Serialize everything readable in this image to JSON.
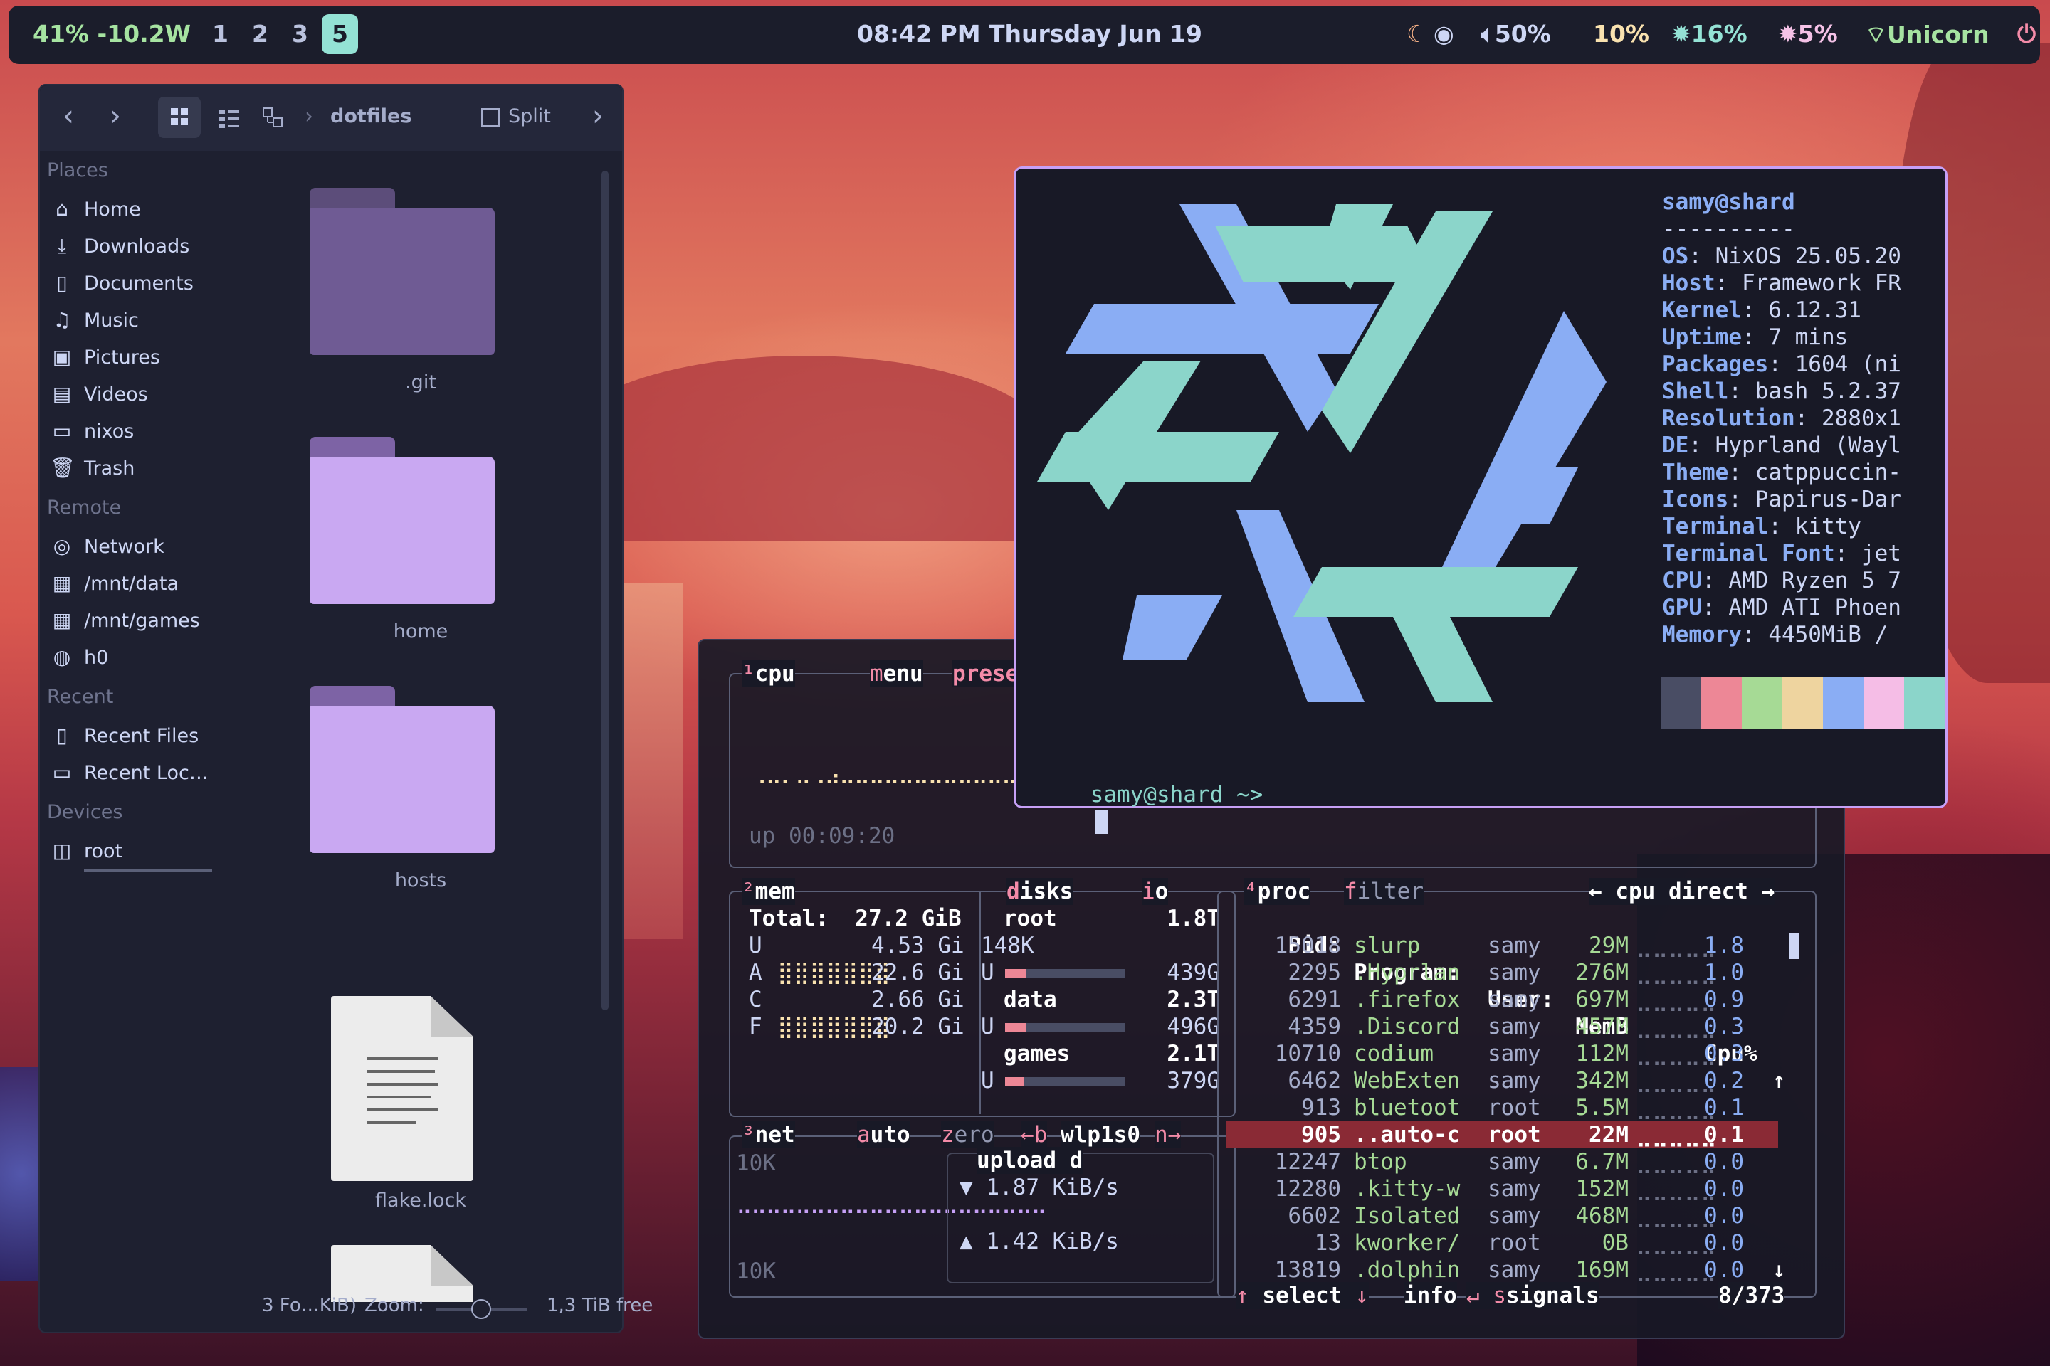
{
  "topbar": {
    "battery": "41% -10.2W",
    "workspaces": [
      "1",
      "2",
      "3",
      "5"
    ],
    "active_workspace": "5",
    "clock": "08:42 PM  Thursday Jun 19",
    "volume": "50%",
    "brightness": "10%",
    "cpu": "16%",
    "ram": "5%",
    "wifi": "Unicorn",
    "colors": {
      "battery": "#a6e3a1",
      "brightness": "#f9e2af",
      "accent": "#94e2d5"
    }
  },
  "file_manager": {
    "breadcrumb": "dotfiles",
    "split_label": "Split",
    "sections": {
      "places": "Places",
      "remote": "Remote",
      "recent": "Recent",
      "devices": "Devices"
    },
    "places": [
      "Home",
      "Downloads",
      "Documents",
      "Music",
      "Pictures",
      "Videos",
      "nixos",
      "Trash"
    ],
    "remote": [
      "Network",
      "/mnt/data",
      "/mnt/games",
      "h0"
    ],
    "recent": [
      "Recent Files",
      "Recent Loc…"
    ],
    "devices": [
      "root"
    ],
    "files": [
      ".git",
      "home",
      "hosts",
      "flake.lock"
    ],
    "status_left": "3 Fo…KiB)",
    "zoom_label": "Zoom:",
    "free_space": "1,3 TiB free"
  },
  "btop": {
    "cpu_box": {
      "num": "¹",
      "title": "cpu",
      "menu": "menu",
      "preset": "prese",
      "uptime": "up 00:09:20"
    },
    "mem_box": {
      "num": "²",
      "title": "mem",
      "total": "Total:  27.2 GiB",
      "rows": [
        {
          "k": "U",
          "v": "4.53 Gi"
        },
        {
          "k": "A",
          "v": "22.6 Gi"
        },
        {
          "k": "C",
          "v": "2.66 Gi"
        },
        {
          "k": "F",
          "v": "20.2 Gi"
        }
      ]
    },
    "disks_box": {
      "title": "disks",
      "io": "io",
      "disks": [
        {
          "name": "root",
          "size": "1.8T",
          "line2": "148K",
          "used_label": "U",
          "used": "439G"
        },
        {
          "name": "data",
          "size": "2.3T",
          "used_label": "U",
          "used": "496G"
        },
        {
          "name": "games",
          "size": "2.1T",
          "used_label": "U",
          "used": "379G"
        }
      ]
    },
    "net_box": {
      "num": "³",
      "title": "net",
      "auto": "auto",
      "zero": "zero",
      "back": "←b",
      "iface": "wlp1s0",
      "fwd": "n→",
      "scale_top": "10K",
      "scale_bottom": "10K",
      "upload_title": "upload",
      "download_mark": "d",
      "down_rate": "▼ 1.87 KiB/s",
      "up_rate": "▲ 1.42 KiB/s"
    },
    "proc_box": {
      "num": "⁴",
      "title": "proc",
      "filter": "filter",
      "sort": "← cpu direct →",
      "headers": [
        "Pid:",
        "Program:",
        "User:",
        "MemB",
        "Cpu%"
      ],
      "rows": [
        {
          "pid": "15018",
          "prog": "slurp",
          "user": "samy",
          "mem": "29M",
          "cpu": "1.8"
        },
        {
          "pid": "2295",
          "prog": ".Hyprlan",
          "user": "samy",
          "mem": "276M",
          "cpu": "1.0"
        },
        {
          "pid": "6291",
          "prog": ".firefox",
          "user": "samy",
          "mem": "697M",
          "cpu": "0.9"
        },
        {
          "pid": "4359",
          "prog": ".Discord",
          "user": "samy",
          "mem": "457M",
          "cpu": "0.3"
        },
        {
          "pid": "10710",
          "prog": "codium",
          "user": "samy",
          "mem": "112M",
          "cpu": "0.3"
        },
        {
          "pid": "6462",
          "prog": "WebExten",
          "user": "samy",
          "mem": "342M",
          "cpu": "0.2"
        },
        {
          "pid": "913",
          "prog": "bluetoot",
          "user": "root",
          "mem": "5.5M",
          "cpu": "0.1"
        },
        {
          "pid": "905",
          "prog": "..auto-c",
          "user": "root",
          "mem": "22M",
          "cpu": "0.1"
        },
        {
          "pid": "12247",
          "prog": "btop",
          "user": "samy",
          "mem": "6.7M",
          "cpu": "0.0"
        },
        {
          "pid": "12280",
          "prog": ".kitty-w",
          "user": "samy",
          "mem": "152M",
          "cpu": "0.0"
        },
        {
          "pid": "6602",
          "prog": "Isolated",
          "user": "samy",
          "mem": "468M",
          "cpu": "0.0"
        },
        {
          "pid": "13",
          "prog": "kworker/",
          "user": "root",
          "mem": "0B",
          "cpu": "0.0"
        },
        {
          "pid": "13819",
          "prog": ".dolphin",
          "user": "samy",
          "mem": "169M",
          "cpu": "0.0"
        }
      ],
      "selected_pid": "905",
      "footer": {
        "select": "select",
        "info": "info",
        "signals": "signals",
        "count": "8/373"
      }
    }
  },
  "fastfetch": {
    "user_host": "samy@shard",
    "separator": "----------",
    "info": [
      {
        "key": "OS",
        "value": "NixOS 25.05.20"
      },
      {
        "key": "Host",
        "value": "Framework FR"
      },
      {
        "key": "Kernel",
        "value": "6.12.31"
      },
      {
        "key": "Uptime",
        "value": "7 mins"
      },
      {
        "key": "Packages",
        "value": "1604 (ni"
      },
      {
        "key": "Shell",
        "value": "bash 5.2.37"
      },
      {
        "key": "Resolution",
        "value": "2880x1"
      },
      {
        "key": "DE",
        "value": "Hyprland (Wayl"
      },
      {
        "key": "Theme",
        "value": "catppuccin-"
      },
      {
        "key": "Icons",
        "value": "Papirus-Dar"
      },
      {
        "key": "Terminal",
        "value": "kitty"
      },
      {
        "key": "Terminal Font",
        "value": "jet"
      },
      {
        "key": "CPU",
        "value": "AMD Ryzen 5 7"
      },
      {
        "key": "GPU",
        "value": "AMD ATI Phoen"
      },
      {
        "key": "Memory",
        "value": "4450MiB /"
      }
    ],
    "palette": [
      "#494d64",
      "#ed8796",
      "#a6da95",
      "#eed49f",
      "#8aadf4",
      "#f5bde6",
      "#8bd5ca"
    ],
    "prompt": "samy@shard ~>",
    "logo_colors": {
      "blue": "#8aadf4",
      "teal": "#8bd5ca"
    }
  }
}
